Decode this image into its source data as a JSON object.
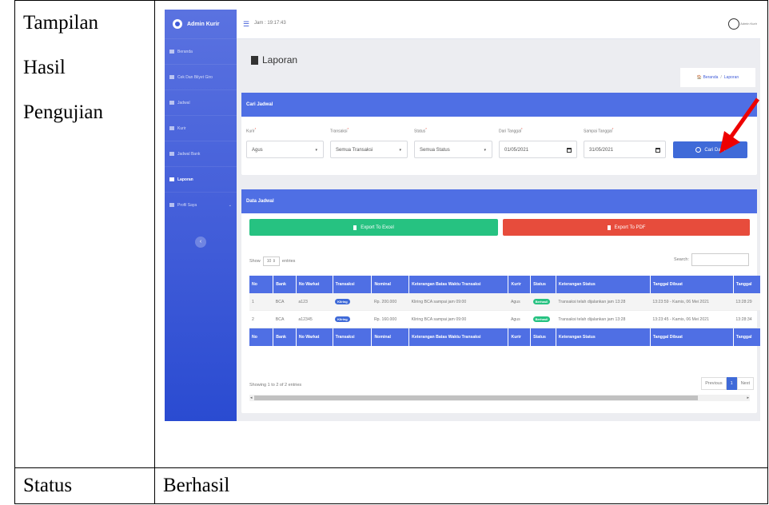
{
  "doc": {
    "labels": [
      "Tampilan",
      "Hasil",
      "Pengujian"
    ],
    "status_label": "Status",
    "status_value": "Berhasil"
  },
  "app": {
    "brand": "Admin Kurir",
    "time": "Jam : 19:17:43",
    "user": "Admin Kurir",
    "sidebar": [
      {
        "label": "Beranda",
        "icon": "home-icon"
      },
      {
        "label": "Cek Dan Bilyet Giro",
        "icon": "table-icon"
      },
      {
        "label": "Jadwal",
        "icon": "list-icon"
      },
      {
        "label": "Kurir",
        "icon": "users-icon"
      },
      {
        "label": "Jadwal Bank",
        "icon": "calendar-icon"
      },
      {
        "label": "Laporan",
        "icon": "document-icon",
        "active": true
      },
      {
        "label": "Profil Saya",
        "icon": "user-icon"
      }
    ],
    "page_title": "Laporan",
    "breadcrumb": [
      "Beranda",
      "Laporan"
    ],
    "search_card": {
      "title": "Cari Jadwal",
      "fields": [
        {
          "label": "Kurir",
          "value": "Agus"
        },
        {
          "label": "Transaksi",
          "value": "Semua Transaksi"
        },
        {
          "label": "Status",
          "value": "Semua Status"
        },
        {
          "label": "Dari Tanggal",
          "value": "01/05/2021"
        },
        {
          "label": "Sampai Tanggal",
          "value": "31/05/2021"
        }
      ],
      "button": "Cari Data"
    },
    "data_card": {
      "title": "Data Jadwal",
      "export_excel": "Export To Excel",
      "export_pdf": "Export To PDF",
      "show": "Show",
      "entries_value": "10",
      "entries": "entries",
      "search": "Search:",
      "headers": [
        "No",
        "Bank",
        "No Warkat",
        "Transaksi",
        "Nominal",
        "Keterangan Batas Waktu Transaksi",
        "Kurir",
        "Status",
        "Keterangan Status",
        "Tanggal Dibuat",
        "Tanggal"
      ],
      "rows": [
        [
          "1",
          "BCA",
          "a123",
          "Kliring",
          "Rp. 200.000",
          "Kliring BCA sampai jam 09:00",
          "Agus",
          "Berhasil",
          "Transaksi telah dijalankan jam 13:28",
          "13:23:59 - Kamis, 06 Mei 2021",
          "13:28:29"
        ],
        [
          "2",
          "BCA",
          "a12345",
          "Kliring",
          "Rp. 160.000",
          "Kliring BCA sampai jam 09:00",
          "Agus",
          "Berhasil",
          "Transaksi telah dijalankan jam 13:28",
          "13:23:45 - Kamis, 06 Mei 2021",
          "13:28:34"
        ]
      ],
      "showing": "Showing 1 to 2 of 2 entries",
      "previous": "Previous",
      "page": "1",
      "next": "Next"
    }
  }
}
